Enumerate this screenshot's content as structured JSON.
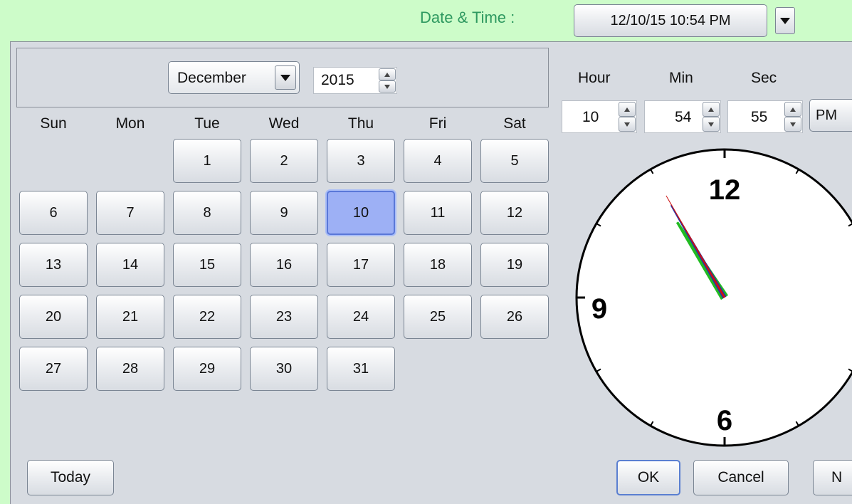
{
  "top": {
    "label": "Date & Time :",
    "field_value": "12/10/15 10:54 PM"
  },
  "calendar": {
    "month": "December",
    "year": "2015",
    "weekdays": [
      "Sun",
      "Mon",
      "Tue",
      "Wed",
      "Thu",
      "Fri",
      "Sat"
    ],
    "days": [
      "1",
      "2",
      "3",
      "4",
      "5",
      "6",
      "7",
      "8",
      "9",
      "10",
      "11",
      "12",
      "13",
      "14",
      "15",
      "16",
      "17",
      "18",
      "19",
      "20",
      "21",
      "22",
      "23",
      "24",
      "25",
      "26",
      "27",
      "28",
      "29",
      "30",
      "31"
    ],
    "selected_day": "10",
    "first_weekday_index": 2,
    "today_label": "Today"
  },
  "time": {
    "hour_label": "Hour",
    "min_label": "Min",
    "sec_label": "Sec",
    "hour": "10",
    "minute": "54",
    "second": "55",
    "ampm": "PM"
  },
  "clock": {
    "numerals": {
      "n12": "12",
      "n9": "9",
      "n6": "6"
    },
    "hour_value": 10,
    "minute_value": 54,
    "second_value": 55,
    "hand_colors": {
      "hour": "#22bb22",
      "minute": "#2233aa",
      "second": "#cc1111"
    }
  },
  "actions": {
    "ok": "OK",
    "cancel": "Cancel",
    "third": "N"
  }
}
